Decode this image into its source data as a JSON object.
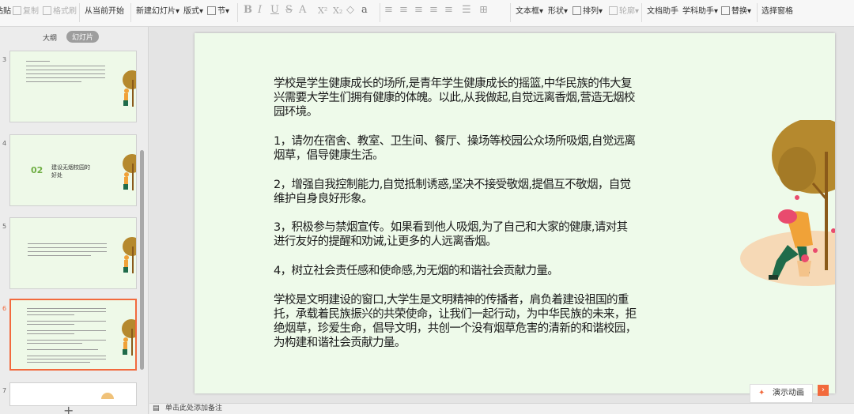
{
  "ribbon": {
    "paste": "贴贴",
    "copy": "复制",
    "format_painter": "格式刷",
    "from_current": "从当前开始",
    "new_slide": "新建幻灯片",
    "layout": "版式",
    "section": "节",
    "text_box": "文本框",
    "shape": "形状",
    "arrange": "排列",
    "outline": "轮廓",
    "doc_assistant": "文档助手",
    "subject_assistant": "学科助手",
    "replace": "替换",
    "select_pane": "选择窗格"
  },
  "panel": {
    "tab_outline": "大纲",
    "tab_slides": "幻灯片",
    "add": "+",
    "thumbs": [
      {
        "num": "3"
      },
      {
        "num": "4",
        "section_no": "02",
        "section_title_1": "建设无烟校园的",
        "section_title_2": "好处"
      },
      {
        "num": "5"
      },
      {
        "num": "6"
      },
      {
        "num": "7"
      }
    ]
  },
  "slide": {
    "paragraphs": [
      "学校是学生健康成长的场所,是青年学生健康成长的摇篮,中华民族的伟大复兴需要大学生们拥有健康的体魄。以此,从我做起,自觉远离香烟,营造无烟校园环境。",
      "1，请勿在宿舍、教室、卫生间、餐厅、操场等校园公众场所吸烟,自觉远离烟草，倡导健康生活。",
      "2，增强自我控制能力,自觉抵制诱惑,坚决不接受敬烟,提倡互不敬烟，自觉维护自身良好形象。",
      "3，积极参与禁烟宣传。如果看到他人吸烟,为了自己和大家的健康,请对其进行友好的提醒和劝诫,让更多的人远离香烟。",
      "4，树立社会责任感和使命感,为无烟的和谐社会贡献力量。",
      "学校是文明建设的窗口,大学生是文明精神的传播者，肩负着建设祖国的重托，承载着民族振兴的共荣使命，让我们一起行动，为中华民族的未来，拒绝烟草，珍爱生命，倡导文明，共创一个没有烟草危害的清新的和谐校园，为构建和谐社会贡献力量。"
    ]
  },
  "animation_button": "演示动画",
  "notes_placeholder": "单击此处添加备注",
  "colors": {
    "slide_bg": "#eefaea",
    "accent": "#f26a3d",
    "tree": "#b5892e",
    "trunk": "#8a5a1a",
    "person_shirt": "#f0a238",
    "pants": "#1f6b4a"
  }
}
